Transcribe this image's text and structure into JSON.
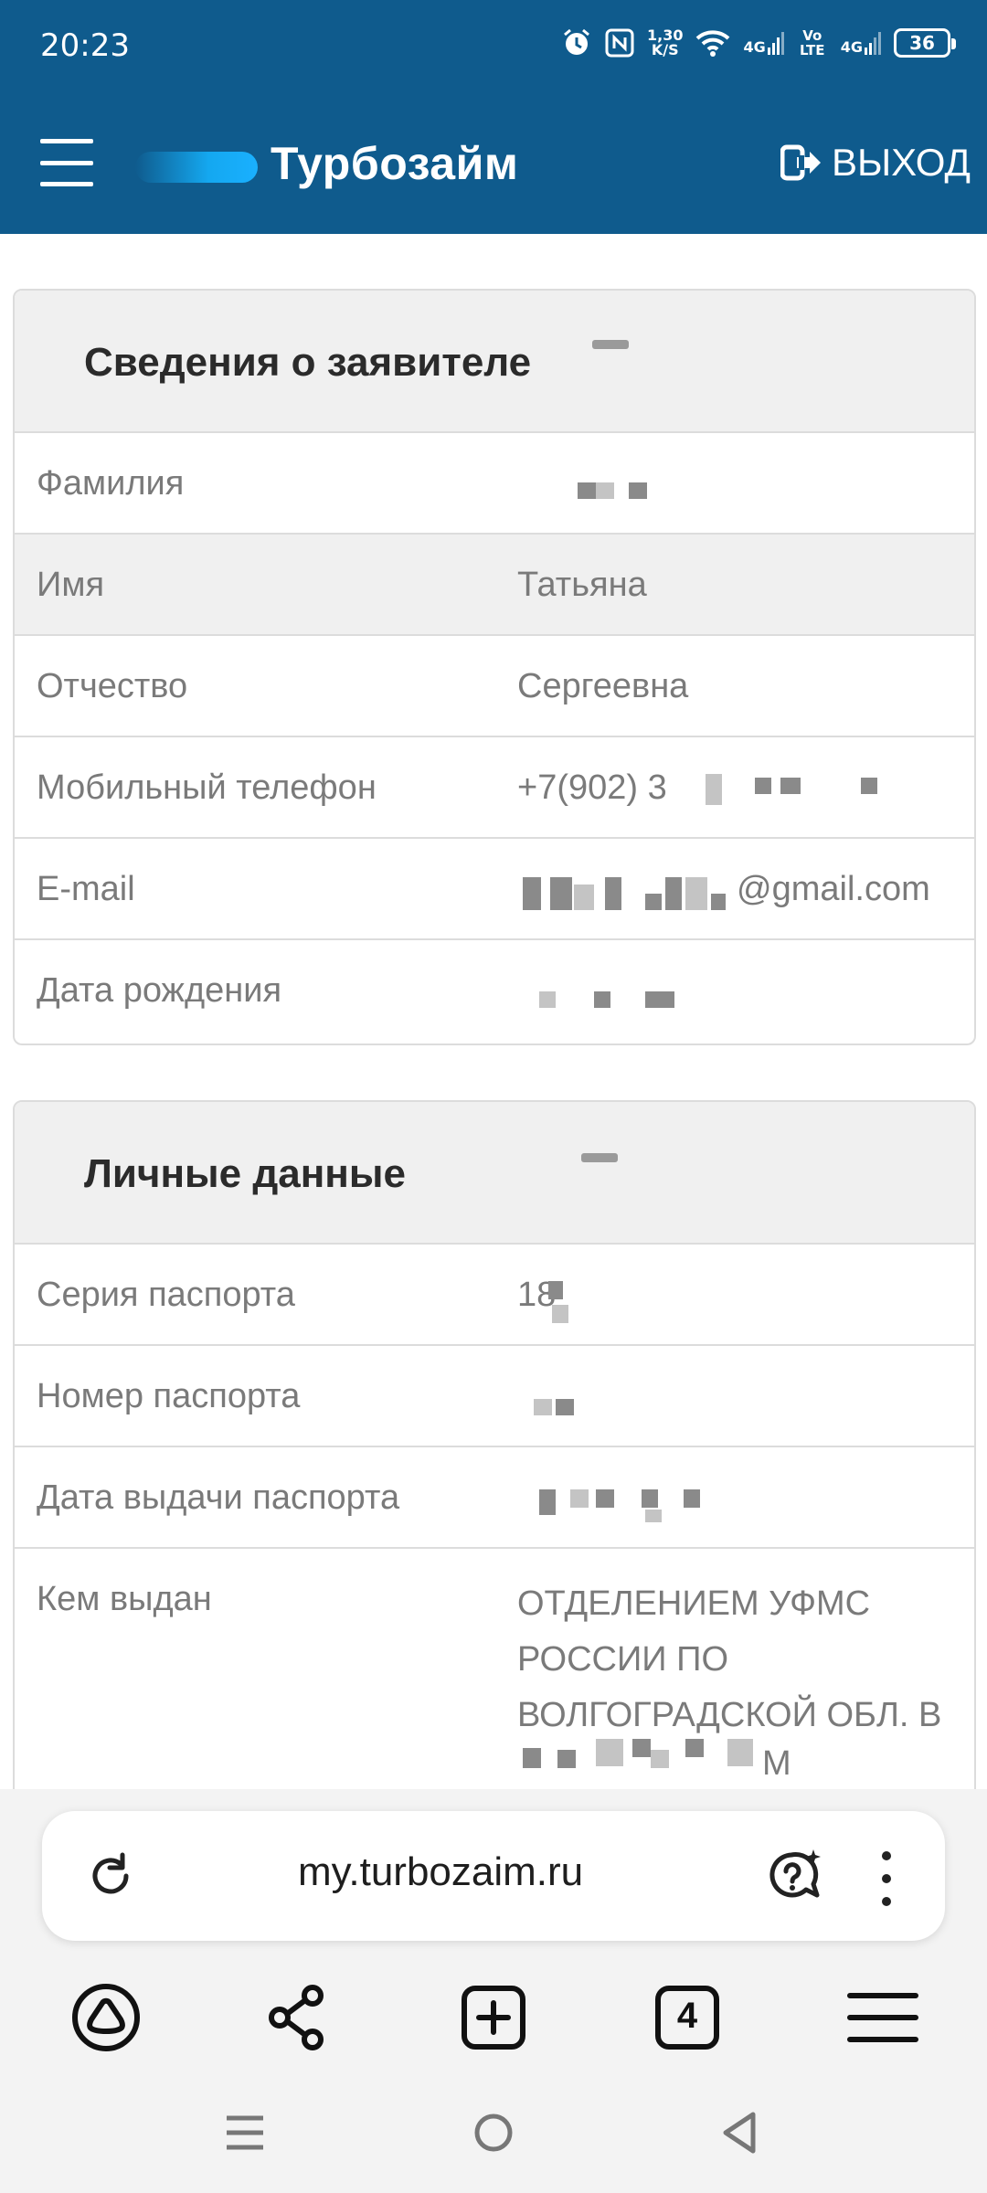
{
  "status_bar": {
    "time": "20:23",
    "icons": [
      "alarm-icon",
      "nfc-icon",
      "wifi-icon",
      "signal-icon",
      "volte-icon",
      "battery-icon"
    ],
    "speed": "1,30",
    "speed_unit": "K/S",
    "net_1": "4G",
    "volte": "Vo LTE",
    "net_2": "4G",
    "battery": "36"
  },
  "header": {
    "brand": "Турбозайм",
    "logout_label": "ВЫХОД",
    "color": "#0f5b8d"
  },
  "applicant_card": {
    "title": "Сведения о заявителе",
    "rows": [
      {
        "label": "Фамилия",
        "value": ""
      },
      {
        "label": "Имя",
        "value": "Татьяна"
      },
      {
        "label": "Отчество",
        "value": "Сергеевна"
      },
      {
        "label": "Мобильный телефон",
        "value": "+7(902) 3"
      },
      {
        "label": "E-mail",
        "value": "@gmail.com"
      },
      {
        "label": "Дата рождения",
        "value": ""
      }
    ]
  },
  "personal_card": {
    "title": "Личные данные",
    "rows": [
      {
        "label": "Серия паспорта",
        "value": "18"
      },
      {
        "label": "Номер паспорта",
        "value": ""
      },
      {
        "label": "Дата выдачи паспорта",
        "value": ""
      },
      {
        "label": "Кем выдан",
        "value": "ОТДЕЛЕНИЕМ УФМС РОССИИ ПО ВОЛГОГРАДСКОЙ ОБЛ. В",
        "value_tail": "М"
      }
    ]
  },
  "browser": {
    "url": "my.turbozaim.ru",
    "tabs_count": "4"
  }
}
